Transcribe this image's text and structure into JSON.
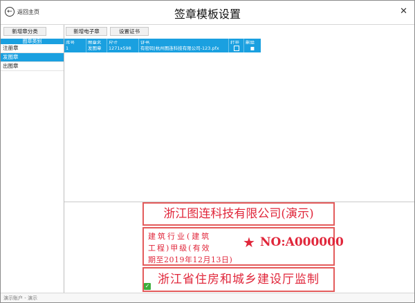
{
  "window": {
    "title": "签章模板设置",
    "back_label": "返回主页",
    "close_glyph": "✕"
  },
  "left_panel": {
    "add_category_label": "新增章分类",
    "list_header": "图章类别",
    "categories": [
      "注册章",
      "发图章",
      "出图章"
    ],
    "selected_index": 1
  },
  "toolbar": {
    "add_stamp_label": "新增电子章",
    "set_cert_label": "设置证书"
  },
  "table": {
    "columns": [
      "序号",
      "图章名",
      "尺寸",
      "证书",
      "打开",
      "删除"
    ],
    "rows": [
      {
        "index": "1",
        "name": "发图章",
        "size": "1271x598",
        "cert": "有密码|杭州图连科技有限公司-123.pfx",
        "open": "",
        "delete": "■"
      }
    ]
  },
  "stamp_preview": {
    "company": "浙江图连科技有限公司(演示)",
    "qualification_line1": "建筑行业(建筑",
    "qualification_line2": "工程)甲级(有效",
    "qualification_line3": "期至2019年12月13日)",
    "number": "NO:A000000",
    "authority": "浙江省住房和城乡建设厅监制",
    "star": "★",
    "color": "#e0263a"
  },
  "status_bar": {
    "text": "演示账户 - 演示"
  },
  "colors": {
    "accent": "#1aa0e0",
    "stamp_border": "#e35a5a"
  }
}
